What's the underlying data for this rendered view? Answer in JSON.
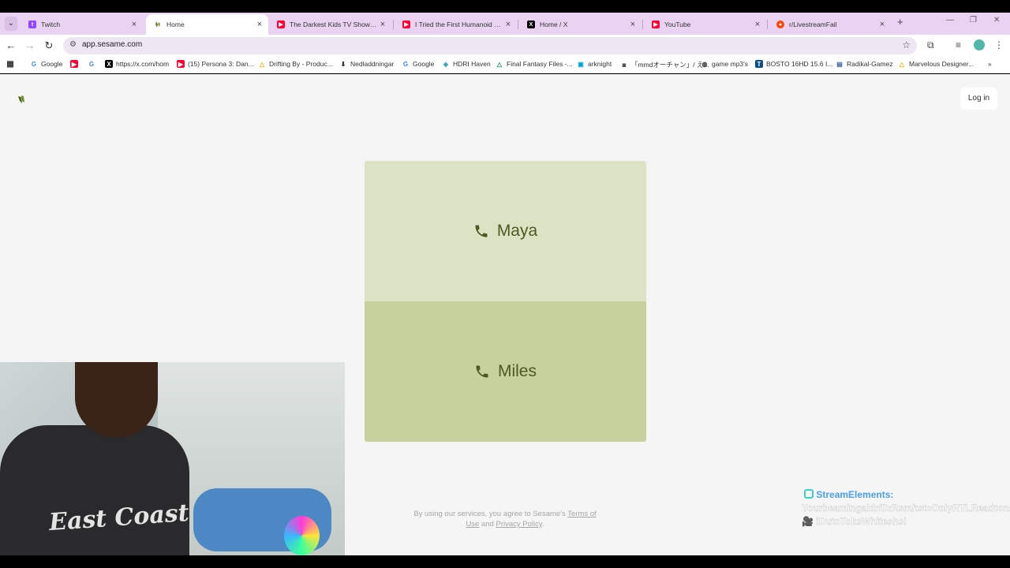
{
  "browser": {
    "tabs": [
      {
        "title": "Twitch",
        "favicon": "twitch-icon",
        "active": false
      },
      {
        "title": "Home",
        "favicon": "sesame-icon",
        "active": true
      },
      {
        "title": "The Darkest Kids TV Show Ever",
        "favicon": "youtube-icon",
        "active": false
      },
      {
        "title": "I Tried the First Humanoid Home",
        "favicon": "youtube-icon",
        "active": false
      },
      {
        "title": "Home / X",
        "favicon": "x-icon",
        "active": false
      },
      {
        "title": "YouTube",
        "favicon": "youtube-icon",
        "active": false
      },
      {
        "title": "r/LivestreamFail",
        "favicon": "reddit-icon",
        "active": false
      }
    ],
    "url": "app.sesame.com",
    "bookmarks": [
      {
        "label": "Google",
        "icon": "google-icon"
      },
      {
        "label": "",
        "icon": "youtube-icon"
      },
      {
        "label": "",
        "icon": "google-icon"
      },
      {
        "label": "https://x.com/hom",
        "icon": "x-icon"
      },
      {
        "label": "(15) Persona 3: Dan...",
        "icon": "youtube-icon"
      },
      {
        "label": "Drifting By - Produc...",
        "icon": "drive-icon"
      },
      {
        "label": "Nedladdningar",
        "icon": "download-icon"
      },
      {
        "label": "Google",
        "icon": "google-icon"
      },
      {
        "label": "HDRI Haven",
        "icon": "hdri-icon"
      },
      {
        "label": "Final Fantasy Files -...",
        "icon": "drive-icon"
      },
      {
        "label": "arknight",
        "icon": "bilibili-icon"
      },
      {
        "label": "「mmdオーチャン」/ え...",
        "icon": "niconico-icon"
      },
      {
        "label": "game mp3's",
        "icon": "globe-icon"
      },
      {
        "label": "BOSTO 16HD 15.6 I...",
        "icon": "bosto-icon"
      },
      {
        "label": "Radikal-Gamez",
        "icon": "radikal-icon"
      },
      {
        "label": "Marvelous Designer...",
        "icon": "drive-icon"
      }
    ]
  },
  "page": {
    "login_label": "Log in",
    "characters": [
      {
        "name": "Maya",
        "icon": "phone-icon"
      },
      {
        "name": "Miles",
        "icon": "phone-icon"
      }
    ],
    "legal": {
      "prefix": "By using our services, you agree to Sesame's ",
      "terms_label": "Terms of Use",
      "and": " and ",
      "privacy_label": "Privacy Policy",
      "suffix": "."
    }
  },
  "stream_overlay": {
    "source": "StreamElements:",
    "message": "Yourbeamingaldr/D:Rsm/tstcOnlyRTLReadtonsLIVE 🎥 iDutoToksWhiteshsl"
  },
  "colors": {
    "maya_card": "#dce3c4",
    "miles_card": "#c6d19e",
    "text_green": "#4a5a22",
    "tabstrip": "#e9d2f2"
  }
}
